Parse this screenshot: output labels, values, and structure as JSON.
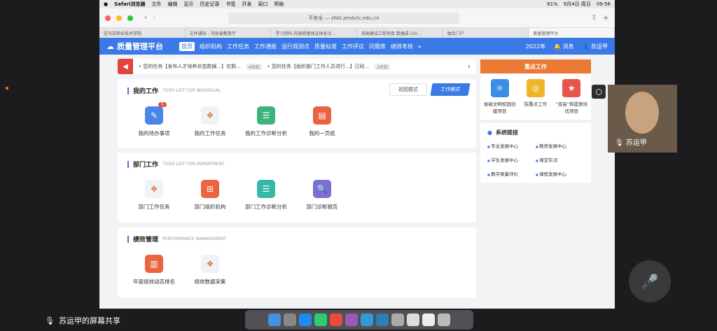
{
  "menubar": {
    "app": "Safari浏览器",
    "items": [
      "文件",
      "编辑",
      "显示",
      "历史记录",
      "书签",
      "开发",
      "窗口",
      "帮助"
    ],
    "battery": "81%",
    "date": "9月4日 周日",
    "time": "09:56"
  },
  "browser": {
    "address": "不安全 — zhkt.zmdvtc.edu.cn",
    "tabs": [
      "驻马店职业技术学院",
      "文件通知 - 河南省教育厅",
      "学习资料-内部质量保证体系诊...",
      "双高建设工程项目 数据成 (20...",
      "融合门户",
      "质量管理平台"
    ]
  },
  "navbar": {
    "title": "质量管理平台",
    "items": [
      "首页",
      "组织机构",
      "工作任务",
      "工作通报",
      "运行观测点",
      "质量标准",
      "工作评议",
      "问题库",
      "绩效考核"
    ],
    "year": "2022年",
    "msg": "消息",
    "user": "苏运甲"
  },
  "notice": {
    "items": [
      {
        "text": "您的任务【发布人才培养状态数据...】仅剩...",
        "tag": "4天前"
      },
      {
        "text": "您的任务【组织部门工作人员进行...】已经...",
        "tag": "2月前"
      }
    ]
  },
  "my_work": {
    "title": "我的工作",
    "en": "TODO LIST FOR INDIVIDUAL",
    "mode_view": "视图模式",
    "mode_work": "工作模式",
    "badge": "5",
    "items": [
      "我的待办事项",
      "我的工作任务",
      "我的工作诊断分析",
      "我的一页纸"
    ]
  },
  "dept_work": {
    "title": "部门工作",
    "en": "TODO LIST FOR DEPARTMENT",
    "items": [
      "部门工作任务",
      "部门组织机构",
      "部门工作诊断分析",
      "部门诊断报告"
    ]
  },
  "perf": {
    "title": "绩效管理",
    "en": "PERFORMANCE MANAGEMENT",
    "items": [
      "年度绩效动态排名",
      "绩效数据采集"
    ]
  },
  "key_work": {
    "title": "重点工作",
    "items": [
      "省级文明校园创建项目",
      "院重点工作",
      "“双高”和提质培优项目"
    ]
  },
  "sys_links": {
    "title": "系统链接",
    "items": [
      "专业发展中心",
      "教师发展中心",
      "学生发展中心",
      "课堂实况",
      "教学质量评价",
      "课程发展中心"
    ]
  },
  "meeting": {
    "share_label": "苏运甲的屏幕共享",
    "cam_name": "苏运甲"
  },
  "colors": {
    "brand": "#3b7ae6",
    "accent": "#ea7a34",
    "alert": "#e0443c"
  }
}
